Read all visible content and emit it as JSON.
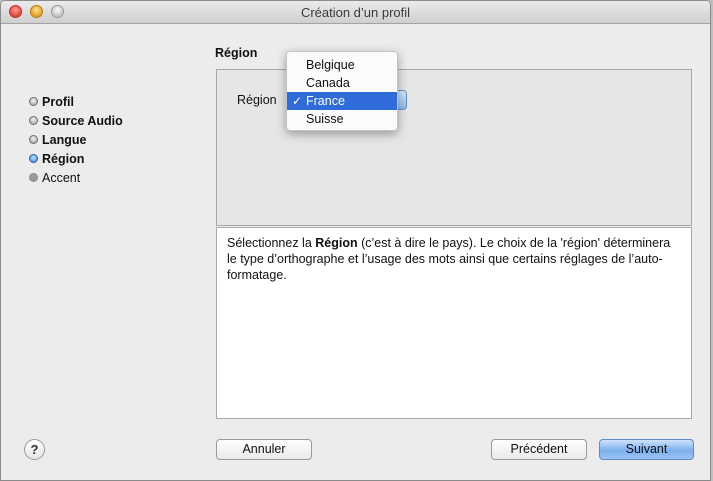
{
  "window": {
    "title": "Création d’un profil"
  },
  "steps": [
    {
      "label": "Profil",
      "state": "done"
    },
    {
      "label": "Source Audio",
      "state": "done"
    },
    {
      "label": "Langue",
      "state": "done"
    },
    {
      "label": "Région",
      "state": "current"
    },
    {
      "label": "Accent",
      "state": "todo"
    }
  ],
  "section": {
    "title": "Région"
  },
  "region_field": {
    "label": "Région",
    "selected": "France",
    "options": [
      "Belgique",
      "Canada",
      "France",
      "Suisse"
    ],
    "check_glyph": "✓"
  },
  "description": {
    "part1": "Sélectionnez la ",
    "bold": "Région",
    "part2": " (c’est à dire le pays). Le choix de la 'région' déterminera le type d’orthographe et l’usage des mots ainsi que certains réglages de l’auto-formatage."
  },
  "buttons": {
    "help": "?",
    "cancel": "Annuler",
    "previous": "Précédent",
    "next": "Suivant"
  },
  "colors": {
    "selection": "#2f6bd9",
    "default_button": "#7cb0ee",
    "current_step_dot": "#3b7fd6"
  }
}
